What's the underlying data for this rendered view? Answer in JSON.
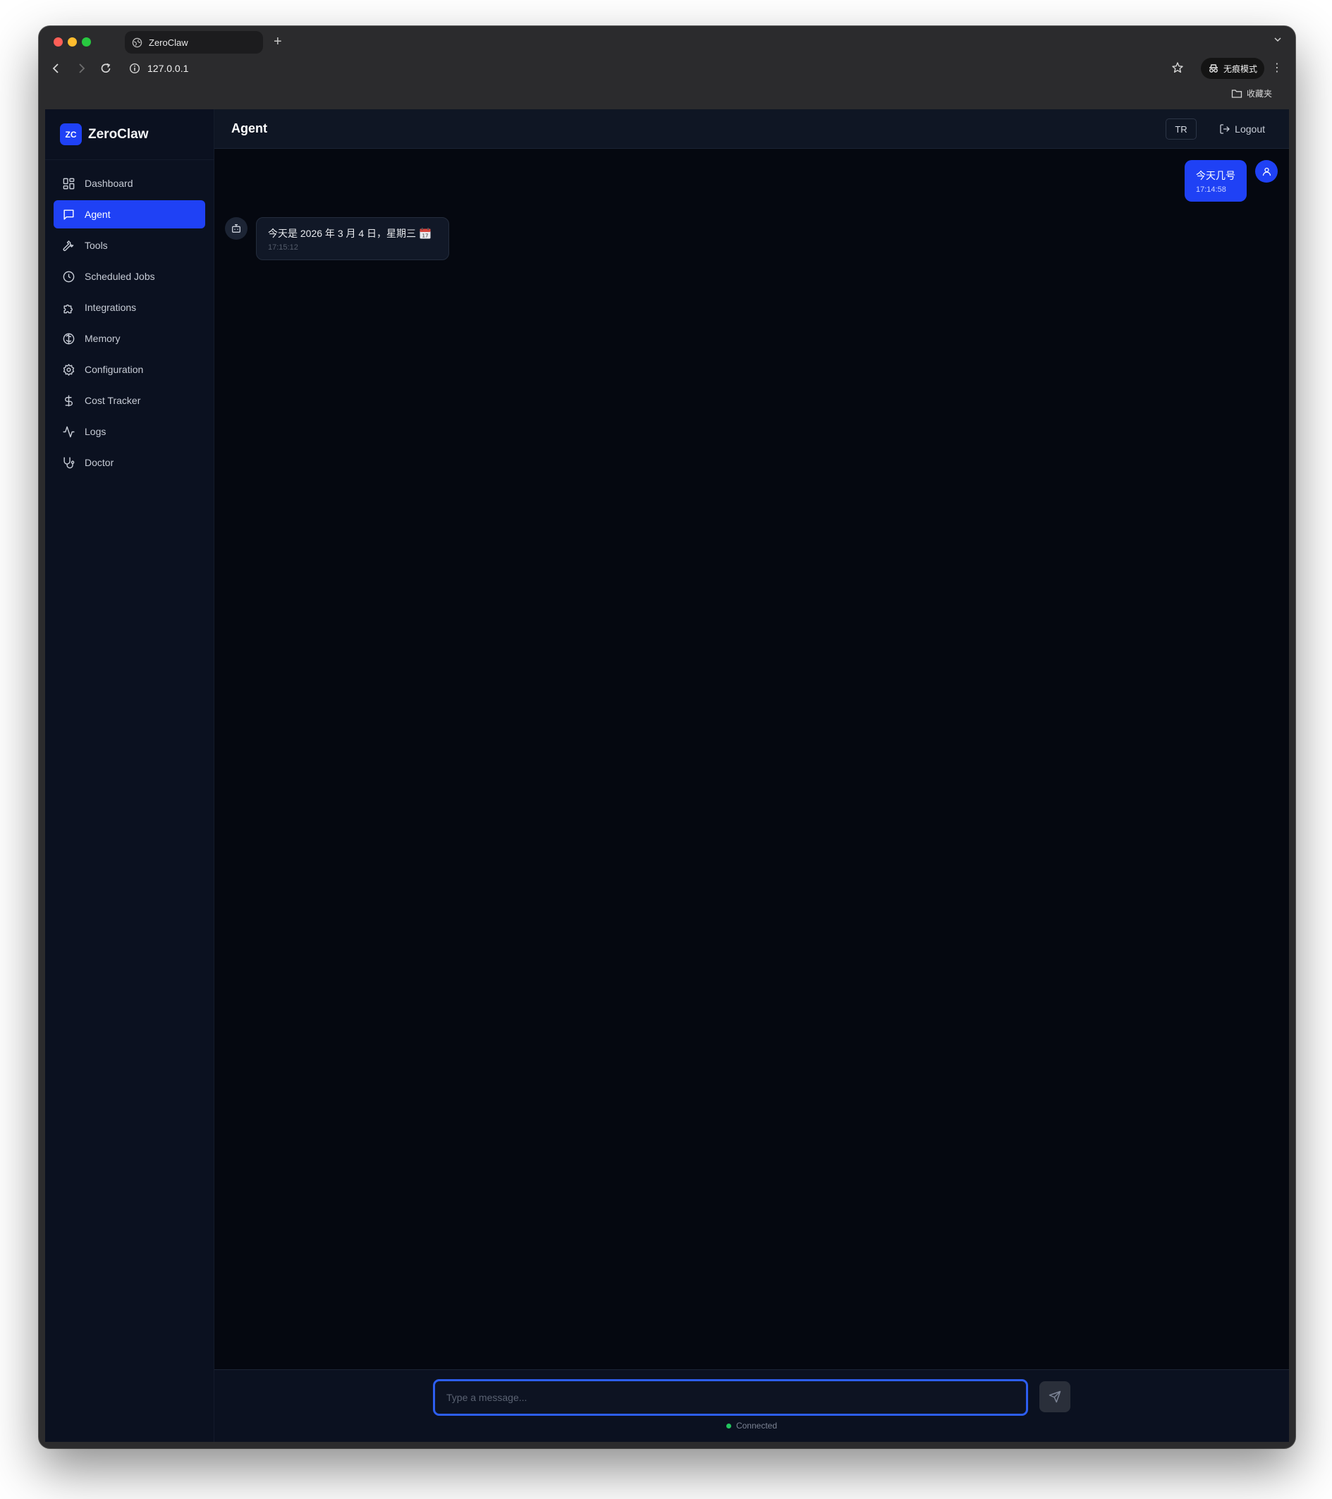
{
  "browser": {
    "tab_title": "ZeroClaw",
    "new_tab_label": "+",
    "url": "127.0.0.1",
    "incognito_label": "无痕模式",
    "bookmarks_folder": "收藏夹"
  },
  "app": {
    "brand_logo": "ZC",
    "brand_name": "ZeroClaw",
    "accent_color": "#1f41f5"
  },
  "sidebar": {
    "items": [
      {
        "label": "Dashboard",
        "icon": "dashboard-icon",
        "active": false
      },
      {
        "label": "Agent",
        "icon": "message-icon",
        "active": true
      },
      {
        "label": "Tools",
        "icon": "wrench-icon",
        "active": false
      },
      {
        "label": "Scheduled Jobs",
        "icon": "clock-icon",
        "active": false
      },
      {
        "label": "Integrations",
        "icon": "puzzle-icon",
        "active": false
      },
      {
        "label": "Memory",
        "icon": "brain-icon",
        "active": false
      },
      {
        "label": "Configuration",
        "icon": "gear-icon",
        "active": false
      },
      {
        "label": "Cost Tracker",
        "icon": "dollar-icon",
        "active": false
      },
      {
        "label": "Logs",
        "icon": "activity-icon",
        "active": false
      },
      {
        "label": "Doctor",
        "icon": "stethoscope-icon",
        "active": false
      }
    ]
  },
  "header": {
    "title": "Agent",
    "language_label": "TR",
    "logout_label": "Logout"
  },
  "chat": {
    "messages": [
      {
        "role": "user",
        "text": "今天几号",
        "time": "17:14:58"
      },
      {
        "role": "assistant",
        "text": "今天是 2026 年 3 月 4 日，星期三",
        "emoji": "📅",
        "time": "17:15:12"
      }
    ]
  },
  "composer": {
    "placeholder": "Type a message...",
    "value": "",
    "status_label": "Connected",
    "status_color": "#22c55e"
  }
}
